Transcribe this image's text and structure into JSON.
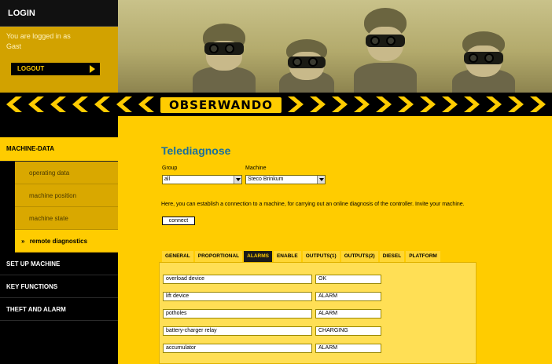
{
  "login": {
    "header": "LOGIN",
    "status_text": "You are logged in as",
    "username": "Gast",
    "logout_label": "LOGOUT"
  },
  "brand": {
    "name": "OBSERWANDO"
  },
  "nav": {
    "sections": [
      {
        "label": "MACHINE-DATA"
      },
      {
        "label": "SET UP MACHINE"
      },
      {
        "label": "KEY FUNCTIONS"
      },
      {
        "label": "THEFT AND ALARM"
      }
    ],
    "sub_items": [
      {
        "label": "operating data"
      },
      {
        "label": "machine position"
      },
      {
        "label": "machine state"
      },
      {
        "label": "remote diagnostics",
        "marker": "»"
      }
    ]
  },
  "main": {
    "title": "Telediagnose",
    "group_label": "Group",
    "group_value": "all",
    "machine_label": "Machine",
    "machine_value": "Steco Brinkum",
    "info_text": "Here, you can establish a connection to a machine, for carrying out an online diagnosis of the controller. Invite your machine.",
    "connect_label": "connect"
  },
  "tabs": [
    {
      "label": "GENERAL",
      "active": false
    },
    {
      "label": "PROPORTIONAL",
      "active": false
    },
    {
      "label": "ALARMS",
      "active": true
    },
    {
      "label": "ENABLE",
      "active": false
    },
    {
      "label": "OUTPUTS(1)",
      "active": false
    },
    {
      "label": "OUTPUTS(2)",
      "active": false
    },
    {
      "label": "DIESEL",
      "active": false
    },
    {
      "label": "PLATFORM",
      "active": false
    }
  ],
  "alarms": [
    {
      "name": "overload device",
      "status": "OK"
    },
    {
      "name": "lift device",
      "status": "ALARM"
    },
    {
      "name": "potholes",
      "status": "ALARM"
    },
    {
      "name": "battery-charger relay",
      "status": "CHARGING"
    },
    {
      "name": "accumulator",
      "status": "ALARM"
    }
  ],
  "colors": {
    "brand_yellow": "#ffcc00",
    "title_blue": "#1a6f9c",
    "black": "#000000"
  }
}
